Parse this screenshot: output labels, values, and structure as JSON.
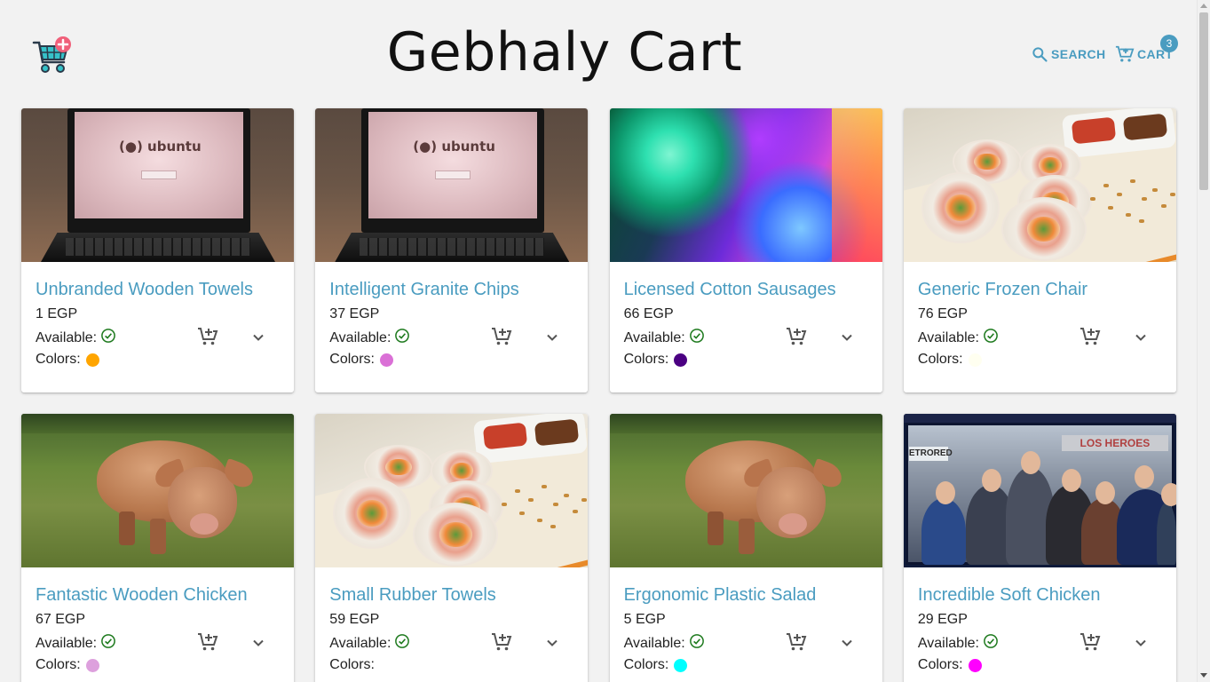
{
  "header": {
    "title": "Gebhaly Cart",
    "search_label": "SEARCH",
    "cart_label": "CART",
    "cart_count": "3"
  },
  "icons": {
    "logo": "cart-plus-logo-icon",
    "search": "search-icon",
    "cart": "cart-icon",
    "available": "check-circle-icon",
    "add_to_cart": "add-shopping-cart-icon",
    "expand": "chevron-down-icon"
  },
  "labels": {
    "available": "Available:",
    "colors": "Colors:"
  },
  "colors": {
    "accent": "#4a9cc0",
    "available_check": "#1e7a1e",
    "badge": "#4a9cc0"
  },
  "products": [
    {
      "title": "Unbranded Wooden Towels",
      "price": "1 EGP",
      "color": "#ffa500",
      "image": "laptop"
    },
    {
      "title": "Intelligent Granite Chips",
      "price": "37 EGP",
      "color": "#da70d6",
      "image": "laptop"
    },
    {
      "title": "Licensed Cotton Sausages",
      "price": "66 EGP",
      "color": "#4b0082",
      "image": "lights"
    },
    {
      "title": "Generic Frozen Chair",
      "price": "76 EGP",
      "color": "#fffff0",
      "image": "sushi"
    },
    {
      "title": "Fantastic Wooden Chicken",
      "price": "67 EGP",
      "color": "#dda0dd",
      "image": "pig"
    },
    {
      "title": "Small Rubber Towels",
      "price": "59 EGP",
      "color": "#ffffff",
      "image": "sushi"
    },
    {
      "title": "Ergonomic Plastic Salad",
      "price": "5 EGP",
      "color": "#00ffff",
      "image": "pig"
    },
    {
      "title": "Incredible Soft Chicken",
      "price": "29 EGP",
      "color": "#ff00ff",
      "image": "bus"
    }
  ]
}
